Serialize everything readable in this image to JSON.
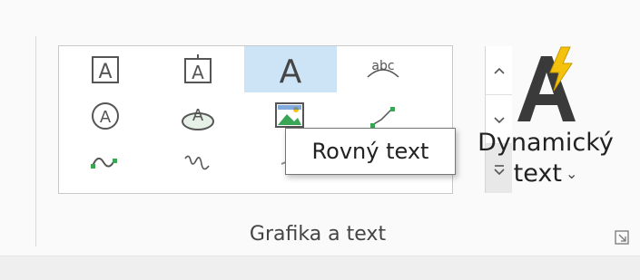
{
  "gallery": {
    "items": [
      {
        "icon": "text-box-icon",
        "row": 0,
        "col": 0
      },
      {
        "icon": "stacked-text-icon",
        "row": 0,
        "col": 1
      },
      {
        "icon": "straight-text-icon",
        "row": 0,
        "col": 2,
        "selected": true
      },
      {
        "icon": "curved-text-icon",
        "row": 0,
        "col": 3
      },
      {
        "icon": "circle-text-icon",
        "row": 1,
        "col": 0
      },
      {
        "icon": "ellipse-text-icon",
        "row": 1,
        "col": 1
      },
      {
        "icon": "picture-icon",
        "row": 1,
        "col": 2
      },
      {
        "icon": "polyline-text-icon",
        "row": 1,
        "col": 3
      },
      {
        "icon": "wavy-text-icon",
        "row": 2,
        "col": 0
      },
      {
        "icon": "freehand-text-icon",
        "row": 2,
        "col": 1
      },
      {
        "icon": "line-text-icon",
        "row": 2,
        "col": 2
      },
      {
        "icon": "point-text-icon",
        "row": 2,
        "col": 3
      }
    ],
    "letter_a": "A",
    "curved_sample": "abc",
    "scroll_up_icon": "chevron-up-icon",
    "more_icon": "more-icon"
  },
  "dynamic_text": {
    "label_line1": "Dynamický",
    "label_line2": "text",
    "caret": "⌄",
    "icon": "dynamic-text-icon",
    "bolt_color": "#f4c20d"
  },
  "tooltip": {
    "text": "Rovný text"
  },
  "group": {
    "label": "Grafika a text",
    "launcher_icon": "dialog-launcher-icon"
  },
  "colors": {
    "selected_cell": "#cde4f7",
    "icon_gray": "#555555",
    "icon_green": "#3aa655",
    "icon_blue": "#2b73c5"
  }
}
